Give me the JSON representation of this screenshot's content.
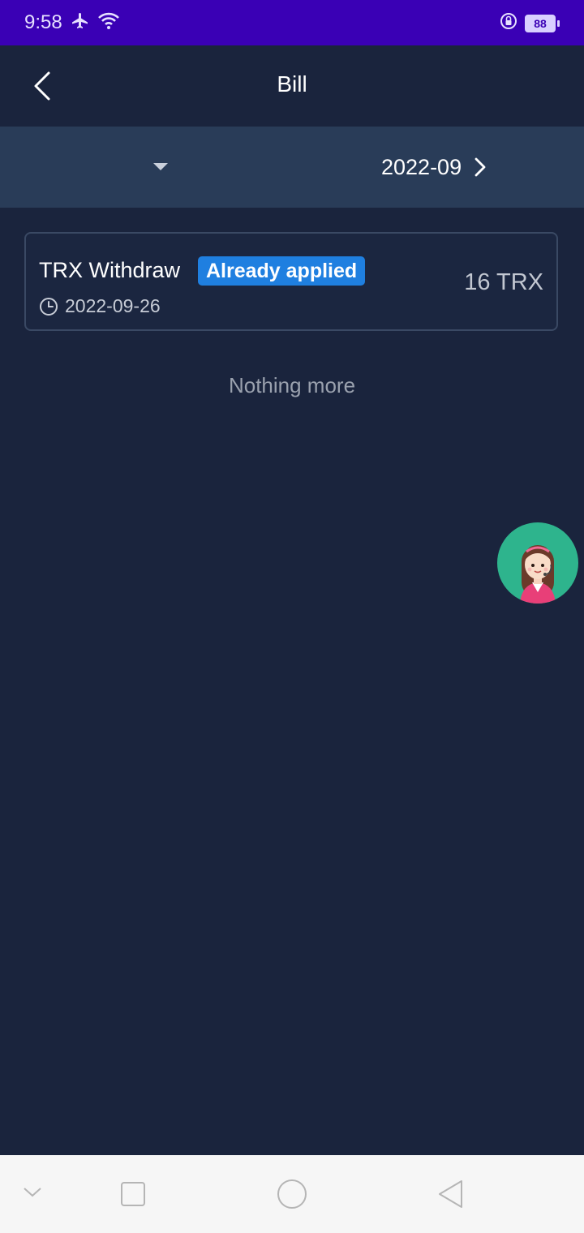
{
  "status_bar": {
    "time": "9:58",
    "battery_level": "88",
    "icons": [
      "airplane-icon",
      "wifi-icon",
      "rotation-lock-icon",
      "battery-icon"
    ]
  },
  "header": {
    "title": "Bill",
    "back_icon": "chevron-left-icon"
  },
  "filter": {
    "dropdown_icon": "caret-down-icon",
    "month": "2022-09",
    "next_icon": "chevron-right-icon"
  },
  "bills": [
    {
      "type": "TRX Withdraw",
      "status": "Already applied",
      "date": "2022-09-26",
      "amount": "16 TRX"
    }
  ],
  "list_end_text": "Nothing more",
  "support": {
    "icon": "customer-service-avatar-icon"
  },
  "nav_bar": {
    "items": [
      "collapse-icon",
      "recents-icon",
      "home-icon",
      "back-icon"
    ]
  },
  "colors": {
    "status_bar": "#3a00b5",
    "background": "#1a243d",
    "filter_bar": "#293c58",
    "status_badge": "#1f7fe0",
    "support_fab": "#2eb48d"
  }
}
